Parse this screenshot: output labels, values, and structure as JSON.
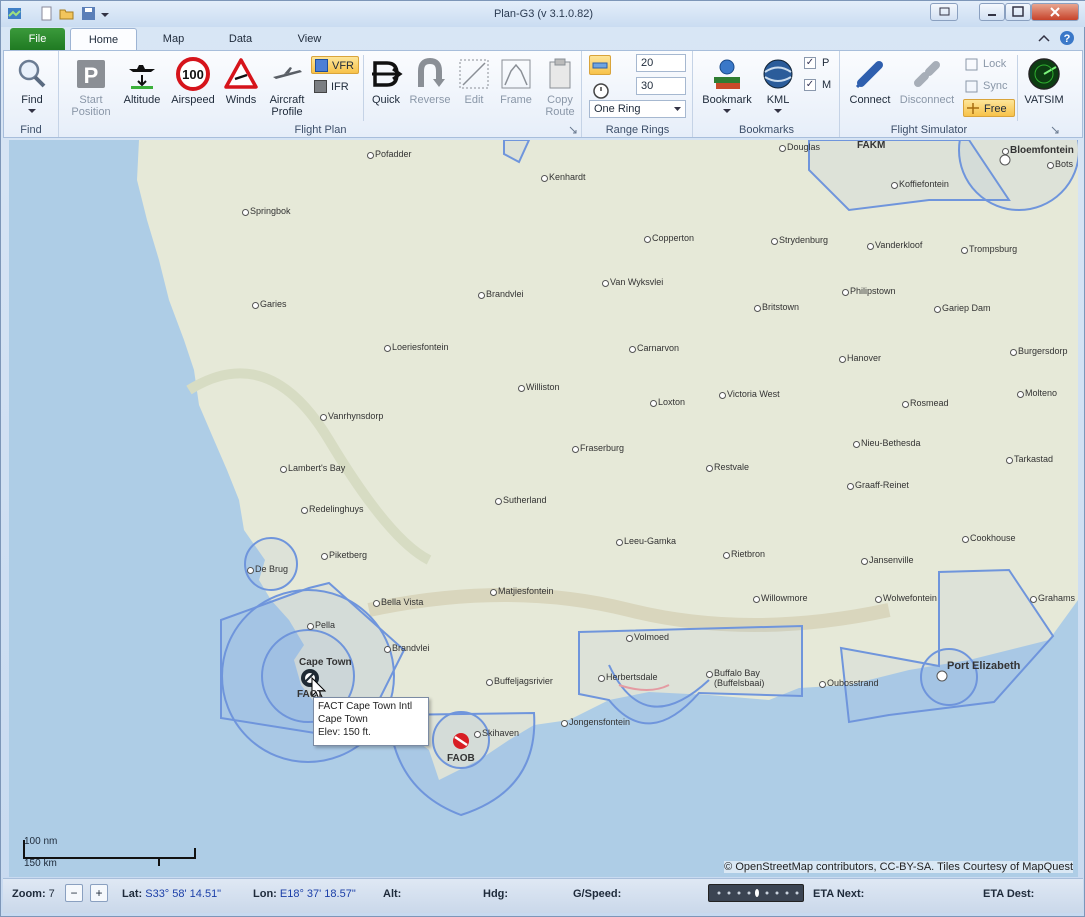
{
  "window": {
    "title": "Plan-G3 (v 3.1.0.82)"
  },
  "tabs": {
    "file": "File",
    "home": "Home",
    "map": "Map",
    "data": "Data",
    "view": "View"
  },
  "ribbon": {
    "find": {
      "label": "Find",
      "group": "Find"
    },
    "flight_plan": {
      "group": "Flight Plan",
      "start_position": "Start Position",
      "altitude": "Altitude",
      "airspeed": "Airspeed",
      "airspeed_badge": "100",
      "winds": "Winds",
      "aircraft_profile": "Aircraft Profile",
      "vfr": "VFR",
      "ifr": "IFR",
      "quick": "Quick",
      "reverse": "Reverse",
      "edit": "Edit",
      "frame": "Frame",
      "copy_route": "Copy Route"
    },
    "range_rings": {
      "group": "Range Rings",
      "value1": "20",
      "value2": "30",
      "mode": "One Ring"
    },
    "bookmarks": {
      "group": "Bookmarks",
      "bookmark": "Bookmark",
      "kml": "KML",
      "p": "P",
      "m": "M"
    },
    "flight_sim": {
      "group": "Flight Simulator",
      "connect": "Connect",
      "disconnect": "Disconnect",
      "lock": "Lock",
      "sync": "Sync",
      "free": "Free",
      "vatsim": "VATSIM"
    }
  },
  "map": {
    "cities": [
      {
        "name": "Pofadder"
      },
      {
        "name": "Kenhardt"
      },
      {
        "name": "Douglas"
      },
      {
        "name": "Bloemfontein"
      },
      {
        "name": "Springbok"
      },
      {
        "name": "Koffiefontein"
      },
      {
        "name": "Bots"
      },
      {
        "name": "Copperton"
      },
      {
        "name": "Strydenburg"
      },
      {
        "name": "Vanderkloof"
      },
      {
        "name": "Trompsburg"
      },
      {
        "name": "Van Wyksvlei"
      },
      {
        "name": "Garies"
      },
      {
        "name": "Brandvlei"
      },
      {
        "name": "Britstown"
      },
      {
        "name": "Philipstown"
      },
      {
        "name": "Gariep Dam"
      },
      {
        "name": "Loeriesfontein"
      },
      {
        "name": "Carnarvon"
      },
      {
        "name": "Hanover"
      },
      {
        "name": "Burgersdorp"
      },
      {
        "name": "Williston"
      },
      {
        "name": "Victoria West"
      },
      {
        "name": "Molteno"
      },
      {
        "name": "Loxton"
      },
      {
        "name": "Rosmead"
      },
      {
        "name": "Vanrhynsdorp"
      },
      {
        "name": "Nieu-Bethesda"
      },
      {
        "name": "Fraserburg"
      },
      {
        "name": "Tarkastad"
      },
      {
        "name": "Lambert's Bay"
      },
      {
        "name": "Restvale"
      },
      {
        "name": "Graaff-Reinet"
      },
      {
        "name": "Sutherland"
      },
      {
        "name": "Redelinghuys"
      },
      {
        "name": "Cookhouse"
      },
      {
        "name": "Leeu-Gamka"
      },
      {
        "name": "Piketberg"
      },
      {
        "name": "Rietbron"
      },
      {
        "name": "Jansenville"
      },
      {
        "name": "De Brug"
      },
      {
        "name": "Matjiesfontein"
      },
      {
        "name": "Wolwefontein"
      },
      {
        "name": "Willowmore"
      },
      {
        "name": "Bella Vista"
      },
      {
        "name": "Grahams"
      },
      {
        "name": "Volmoed"
      },
      {
        "name": "Brandvlei"
      },
      {
        "name": "Herbertsdale"
      },
      {
        "name": "Buffalo Bay (Buffelsbaai)"
      },
      {
        "name": "Oubosstrand"
      },
      {
        "name": "Buffeljagsrivier"
      },
      {
        "name": "Jongensfontein"
      },
      {
        "name": "Skihaven"
      },
      {
        "name": "Pella"
      }
    ],
    "airports": {
      "cape_town": "Cape Town",
      "fact": "FACT",
      "faob": "FAOB",
      "fakm": "FAKM",
      "port_elizabeth": "Port Elizabeth"
    },
    "tooltip": {
      "line1": "FACT Cape Town Intl",
      "line2": "Cape Town",
      "line3": "Elev: 150 ft."
    },
    "copyright": "© OpenStreetMap contributors, CC-BY-SA. Tiles Courtesy of MapQuest",
    "scale": {
      "nm": "100 nm",
      "km": "150 km"
    }
  },
  "status": {
    "zoom_label": "Zoom:",
    "zoom_value": "7",
    "lat_label": "Lat:",
    "lat_value": "S33° 58' 14.51\"",
    "lon_label": "Lon:",
    "lon_value": "E18° 37' 18.57\"",
    "alt_label": "Alt:",
    "hdg_label": "Hdg:",
    "gspeed_label": "G/Speed:",
    "eta_next_label": "ETA Next:",
    "eta_dest_label": "ETA Dest:"
  },
  "colors": {
    "ribbon_accent": "#f7c24a",
    "airspace": "#6f95dc",
    "file_tab": "#2a8a2d",
    "sea": "#a9cbe4",
    "land": "#e7ead8"
  }
}
